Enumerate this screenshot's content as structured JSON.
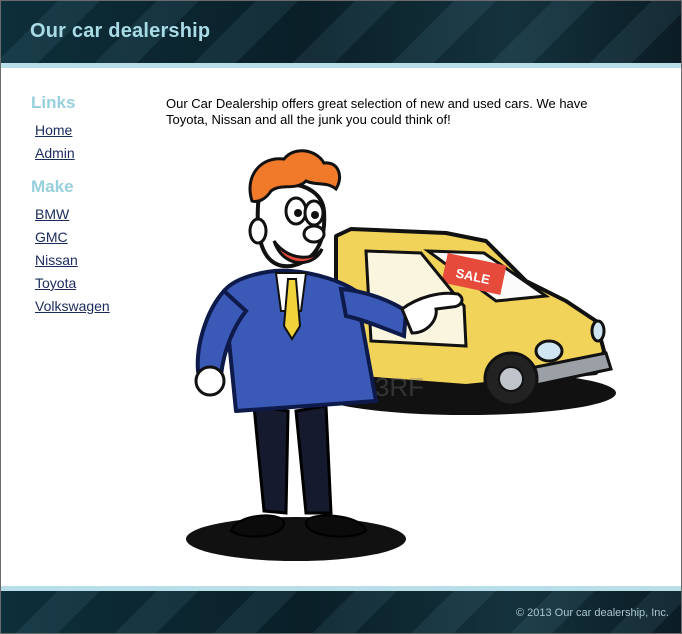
{
  "header": {
    "title": "Our car dealership"
  },
  "sidebar": {
    "links_heading": "Links",
    "links": [
      {
        "label": "Home"
      },
      {
        "label": "Admin"
      }
    ],
    "make_heading": "Make",
    "makes": [
      {
        "label": "BMW"
      },
      {
        "label": "GMC"
      },
      {
        "label": "Nissan"
      },
      {
        "label": "Toyota"
      },
      {
        "label": "Volkswagen"
      }
    ]
  },
  "main": {
    "intro": "Our Car Dealership offers great selection of new and used cars. We have Toyota, Nissan and all the junk you could think of!",
    "illustration": {
      "sign_text": "SALE",
      "watermark": "123RF"
    }
  },
  "footer": {
    "copyright": "© 2013 Our car dealership, Inc."
  },
  "colors": {
    "header_bg": "#0d2f3a",
    "accent": "#b8dfe8",
    "title": "#a9dbe6",
    "sidebar_heading": "#97cfdc",
    "link": "#1a2a5c"
  }
}
